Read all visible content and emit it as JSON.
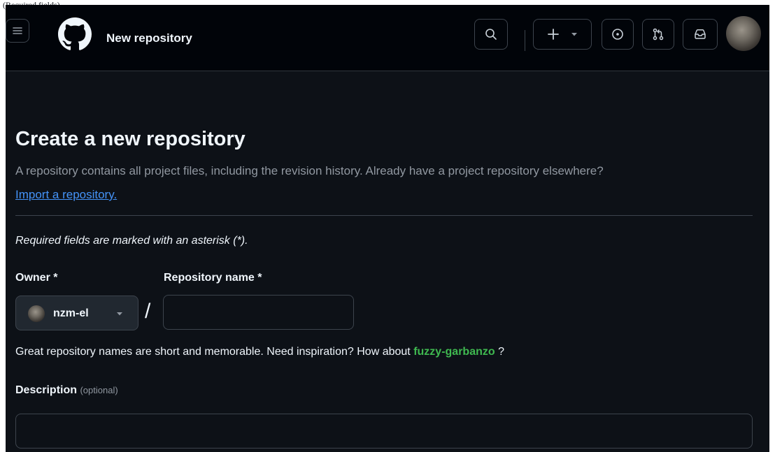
{
  "page_label": "(Required fields)",
  "header": {
    "title": "New repository",
    "icons": [
      "menu-icon",
      "github-logo-icon",
      "search-icon",
      "plus-icon",
      "triangle-down-icon",
      "issue-opened-icon",
      "git-pull-request-icon",
      "inbox-icon"
    ]
  },
  "main": {
    "heading": "Create a new repository",
    "subtitle": "A repository contains all project files, including the revision history. Already have a project repository elsewhere?",
    "import_link": "Import a repository.",
    "required_note": "Required fields are marked with an asterisk (*).",
    "owner": {
      "label": "Owner *",
      "value": "nzm-el"
    },
    "separator": "/",
    "repo_name": {
      "label": "Repository name *",
      "value": "",
      "placeholder": ""
    },
    "suggestion": {
      "prefix": "Great repository names are short and memorable. Need inspiration? How about",
      "name": "fuzzy-garbanzo",
      "suffix": "?"
    },
    "description": {
      "label": "Description",
      "optional": "(optional)",
      "value": "",
      "placeholder": ""
    }
  },
  "colors": {
    "background": "#0d1117",
    "header_background": "#010409",
    "border": "#3d444d",
    "text": "#f0f6fc",
    "muted": "#9198a1",
    "link": "#4493f8",
    "suggestion": "#3fb950"
  }
}
